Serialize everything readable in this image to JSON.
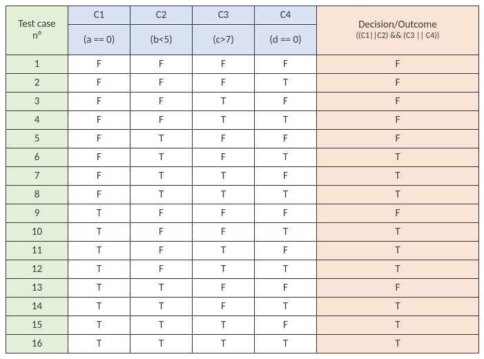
{
  "header": {
    "test_case_label_l1": "Test case",
    "test_case_label_l2": "n°",
    "conditions": [
      {
        "short": "C1",
        "expr": "(a == 0)"
      },
      {
        "short": "C2",
        "expr": "(b<5)"
      },
      {
        "short": "C3",
        "expr": "(c>7)"
      },
      {
        "short": "C4",
        "expr": "(d == 0)"
      }
    ],
    "outcome_label": "Decision/Outcome",
    "outcome_expr": "((C1||C2) && (C3 || C4))"
  },
  "rows": [
    {
      "n": "1",
      "c": [
        "F",
        "F",
        "F",
        "F"
      ],
      "out": "F"
    },
    {
      "n": "2",
      "c": [
        "F",
        "F",
        "F",
        "T"
      ],
      "out": "F"
    },
    {
      "n": "3",
      "c": [
        "F",
        "F",
        "T",
        "F"
      ],
      "out": "F"
    },
    {
      "n": "4",
      "c": [
        "F",
        "F",
        "T",
        "T"
      ],
      "out": "F"
    },
    {
      "n": "5",
      "c": [
        "F",
        "T",
        "F",
        "F"
      ],
      "out": "F"
    },
    {
      "n": "6",
      "c": [
        "F",
        "T",
        "F",
        "T"
      ],
      "out": "T"
    },
    {
      "n": "7",
      "c": [
        "F",
        "T",
        "T",
        "F"
      ],
      "out": "T"
    },
    {
      "n": "8",
      "c": [
        "F",
        "T",
        "T",
        "T"
      ],
      "out": "T"
    },
    {
      "n": "9",
      "c": [
        "T",
        "F",
        "F",
        "F"
      ],
      "out": "F"
    },
    {
      "n": "10",
      "c": [
        "T",
        "F",
        "F",
        "T"
      ],
      "out": "T"
    },
    {
      "n": "11",
      "c": [
        "T",
        "F",
        "T",
        "F"
      ],
      "out": "T"
    },
    {
      "n": "12",
      "c": [
        "T",
        "F",
        "T",
        "T"
      ],
      "out": "T"
    },
    {
      "n": "13",
      "c": [
        "T",
        "T",
        "F",
        "F"
      ],
      "out": "F"
    },
    {
      "n": "14",
      "c": [
        "T",
        "T",
        "F",
        "T"
      ],
      "out": "T"
    },
    {
      "n": "15",
      "c": [
        "T",
        "T",
        "T",
        "F"
      ],
      "out": "T"
    },
    {
      "n": "16",
      "c": [
        "T",
        "T",
        "T",
        "T"
      ],
      "out": "T"
    }
  ]
}
